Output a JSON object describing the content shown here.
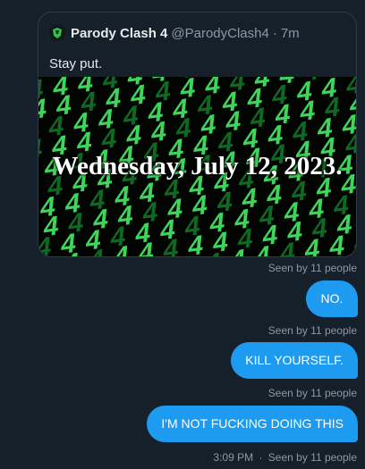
{
  "shared_tweet": {
    "display_name": "Parody Clash 4",
    "handle": "@ParodyClash4",
    "separator": "·",
    "time_ago": "7m",
    "text": "Stay put.",
    "media": {
      "overlay_text": "Wednesday, July 12, 2023.",
      "pattern_glyph": "4",
      "colors": {
        "glyph_bright": "#3ed65a",
        "glyph_dark": "#0e6a22",
        "background": "#020402"
      }
    }
  },
  "messages": [
    {
      "text": "NO.",
      "receipt": "Seen by 11 people"
    },
    {
      "text": "KILL YOURSELF.",
      "receipt": "Seen by 11 people"
    },
    {
      "text": "I'M NOT FUCKING DOING THIS",
      "receipt": "Seen by 11 people"
    }
  ],
  "first_receipt": "Seen by 11 people",
  "last_status": {
    "time": "3:09 PM",
    "separator": "·",
    "receipt": "Seen by 11 people"
  },
  "colors": {
    "background": "#15202b",
    "bubble": "#1d9bf0",
    "muted_text": "#8b98a5"
  }
}
